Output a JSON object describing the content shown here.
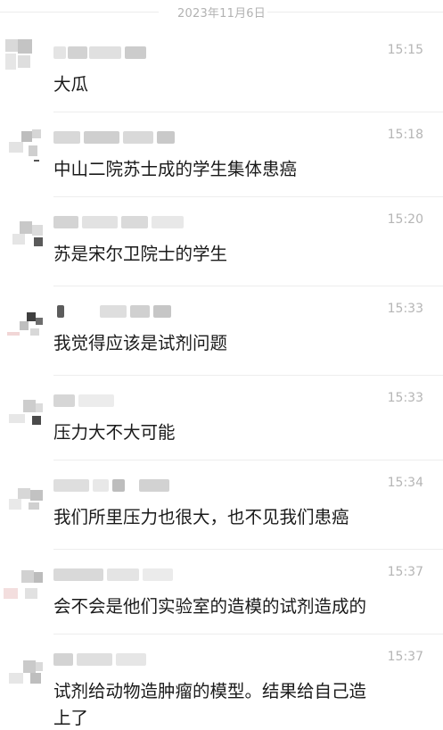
{
  "date_divider": "2023年11月6日",
  "messages": [
    {
      "time": "15:15",
      "lines": [
        "大瓜"
      ]
    },
    {
      "time": "15:18",
      "lines": [
        "中山二院苏士成的学生集体患癌"
      ]
    },
    {
      "time": "15:20",
      "lines": [
        "苏是宋尔卫院士的学生"
      ]
    },
    {
      "time": "15:33",
      "lines": [
        "我觉得应该是试剂问题"
      ]
    },
    {
      "time": "15:33",
      "lines": [
        "压力大不大可能"
      ]
    },
    {
      "time": "15:34",
      "lines": [
        "我们所里压力也很大，也不见我们患癌"
      ]
    },
    {
      "time": "15:37",
      "lines": [
        "会不会是他们实验室的造模的试剂造成的"
      ]
    },
    {
      "time": "15:37",
      "lines": [
        "试剂给动物造肿瘤的模型。结果给自己造",
        "上了"
      ]
    }
  ]
}
